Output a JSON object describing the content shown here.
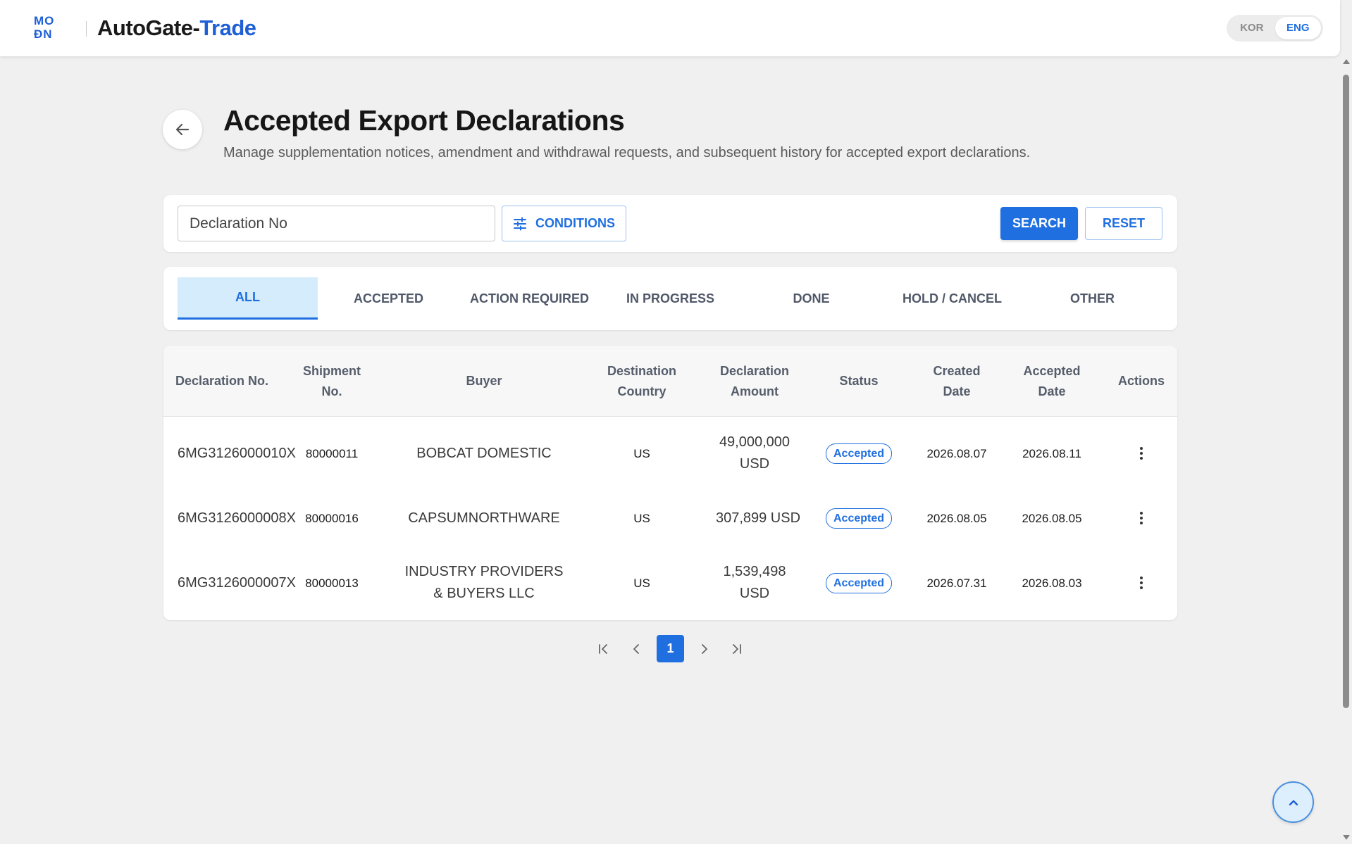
{
  "app": {
    "logo_line1": "MO",
    "logo_line2": "ÐN",
    "brand_main": "AutoGate-",
    "brand_accent": "Trade",
    "languages": [
      "KOR",
      "ENG"
    ],
    "active_language": "ENG"
  },
  "page": {
    "title": "Accepted Export Declarations",
    "subtitle": "Manage supplementation notices, amendment and withdrawal requests, and subsequent history for accepted export declarations."
  },
  "search": {
    "placeholder": "Declaration No",
    "conditions_label": "CONDITIONS",
    "search_label": "SEARCH",
    "reset_label": "RESET"
  },
  "tabs": [
    {
      "label": "ALL",
      "active": true
    },
    {
      "label": "ACCEPTED",
      "active": false
    },
    {
      "label": "ACTION REQUIRED",
      "active": false
    },
    {
      "label": "IN PROGRESS",
      "active": false
    },
    {
      "label": "DONE",
      "active": false
    },
    {
      "label": "HOLD / CANCEL",
      "active": false
    },
    {
      "label": "OTHER",
      "active": false
    }
  ],
  "table": {
    "columns": [
      "Declaration No.",
      "Shipment No.",
      "Buyer",
      "Destination Country",
      "Declaration Amount",
      "Status",
      "Created Date",
      "Accepted Date",
      "Actions"
    ],
    "rows": [
      {
        "declaration_no": "6MG3126000010X",
        "shipment_no": "80000011",
        "buyer": "BOBCAT DOMESTIC",
        "country": "US",
        "amount": "49,000,000 USD",
        "status": "Accepted",
        "created": "2026.08.07",
        "accepted": "2026.08.11"
      },
      {
        "declaration_no": "6MG3126000008X",
        "shipment_no": "80000016",
        "buyer": "CAPSUMNORTHWARE",
        "country": "US",
        "amount": "307,899 USD",
        "status": "Accepted",
        "created": "2026.08.05",
        "accepted": "2026.08.05"
      },
      {
        "declaration_no": "6MG3126000007X",
        "shipment_no": "80000013",
        "buyer": "INDUSTRY PROVIDERS & BUYERS LLC",
        "country": "US",
        "amount": "1,539,498 USD",
        "status": "Accepted",
        "created": "2026.07.31",
        "accepted": "2026.08.03"
      }
    ]
  },
  "pagination": {
    "current_page": "1"
  },
  "colors": {
    "primary": "#1f6fe0",
    "tab_active_bg": "#d4ecfb",
    "background": "#f0f0f0"
  }
}
